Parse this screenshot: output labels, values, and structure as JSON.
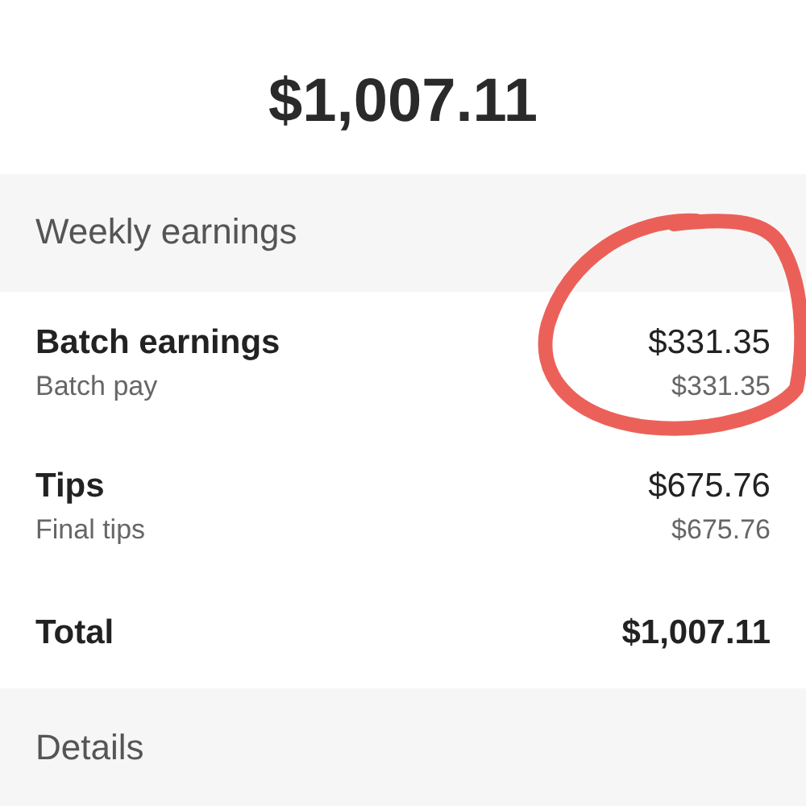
{
  "total_amount": "$1,007.11",
  "weekly_section": {
    "title": "Weekly earnings"
  },
  "rows": [
    {
      "label": "Batch earnings",
      "amount": "$331.35",
      "sub_label": "Batch pay",
      "sub_amount": "$331.35",
      "circled": true
    },
    {
      "label": "Tips",
      "amount": "$675.76",
      "sub_label": "Final tips",
      "sub_amount": "$675.76",
      "circled": false
    }
  ],
  "total": {
    "label": "Total",
    "amount": "$1,007.11"
  },
  "details_section": {
    "title": "Details"
  }
}
